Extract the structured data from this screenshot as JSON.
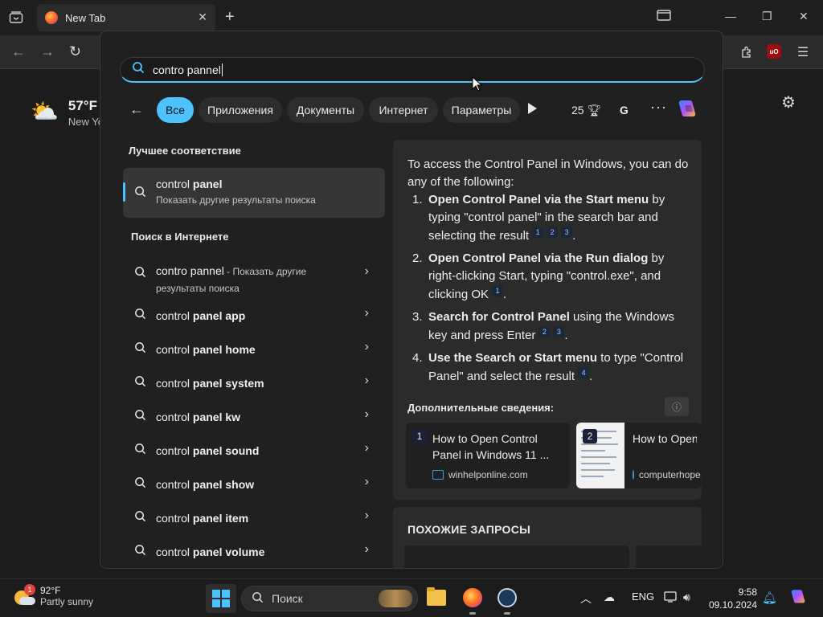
{
  "browser": {
    "tab_title": "New Tab",
    "close_tab": "✕",
    "new_tab": "+",
    "win_min": "—",
    "win_max": "❐",
    "win_close": "✕"
  },
  "newtab_page": {
    "weather_temp": "57°F",
    "weather_location": "New Yo"
  },
  "start_search": {
    "query": "contro pannel",
    "filters": [
      "Все",
      "Приложения",
      "Документы",
      "Интернет",
      "Параметры"
    ],
    "rewards_points": "25",
    "g_letter": "G",
    "more": "···",
    "best_match_title": "Лучшее соответствие",
    "best_match": {
      "prefix": "control ",
      "bold": "panel",
      "subtitle": "Показать другие результаты поиска"
    },
    "web_title": "Поиск в Интернете",
    "web_first": {
      "text": "contro pannel",
      "sub": " - Показать другие результаты поиска"
    },
    "web_items": [
      {
        "prefix": "control ",
        "bold": "panel app"
      },
      {
        "prefix": "control ",
        "bold": "panel home"
      },
      {
        "prefix": "control ",
        "bold": "panel system"
      },
      {
        "prefix": "control ",
        "bold": "panel kw"
      },
      {
        "prefix": "control ",
        "bold": "panel sound"
      },
      {
        "prefix": "control ",
        "bold": "panel show"
      },
      {
        "prefix": "control ",
        "bold": "panel item"
      },
      {
        "prefix": "control ",
        "bold": "panel volume"
      }
    ],
    "preview": {
      "intro": "To access the Control Panel in Windows, you can do any of the following:",
      "steps": [
        {
          "num": "1.",
          "bold": "Open Control Panel via the Start menu",
          "text": " by typing \"control panel\" in the search bar and selecting the result",
          "cites": [
            "1",
            "2",
            "3"
          ]
        },
        {
          "num": "2.",
          "bold": "Open Control Panel via the Run dialog",
          "text": " by right-clicking Start, typing \"control.exe\", and clicking OK",
          "cites": [
            "1"
          ]
        },
        {
          "num": "3.",
          "bold": "Search for Control Panel",
          "text": " using the Windows key and press Enter",
          "cites": [
            "2",
            "3"
          ]
        },
        {
          "num": "4.",
          "bold": "Use the Search or Start menu",
          "text": " to type \"Control Panel\" and select the result",
          "cites": [
            "4"
          ]
        }
      ],
      "more_title": "Дополнительные сведения:",
      "info": "ⓘ",
      "sources": [
        {
          "n": "1",
          "title": "How to Open Control Panel in Windows 11 ...",
          "site": "winhelponline.com"
        },
        {
          "n": "2",
          "title": "How to Open Control Panel in Windows Co...",
          "site": "computerhope.com"
        }
      ],
      "related_title": "ПОХОЖИЕ ЗАПРОСЫ"
    }
  },
  "taskbar": {
    "weather_badge": "1",
    "weather_temp": "92°F",
    "weather_desc": "Partly sunny",
    "search_placeholder": "Поиск",
    "lang": "ENG",
    "time": "9:58",
    "date": "09.10.2024"
  }
}
